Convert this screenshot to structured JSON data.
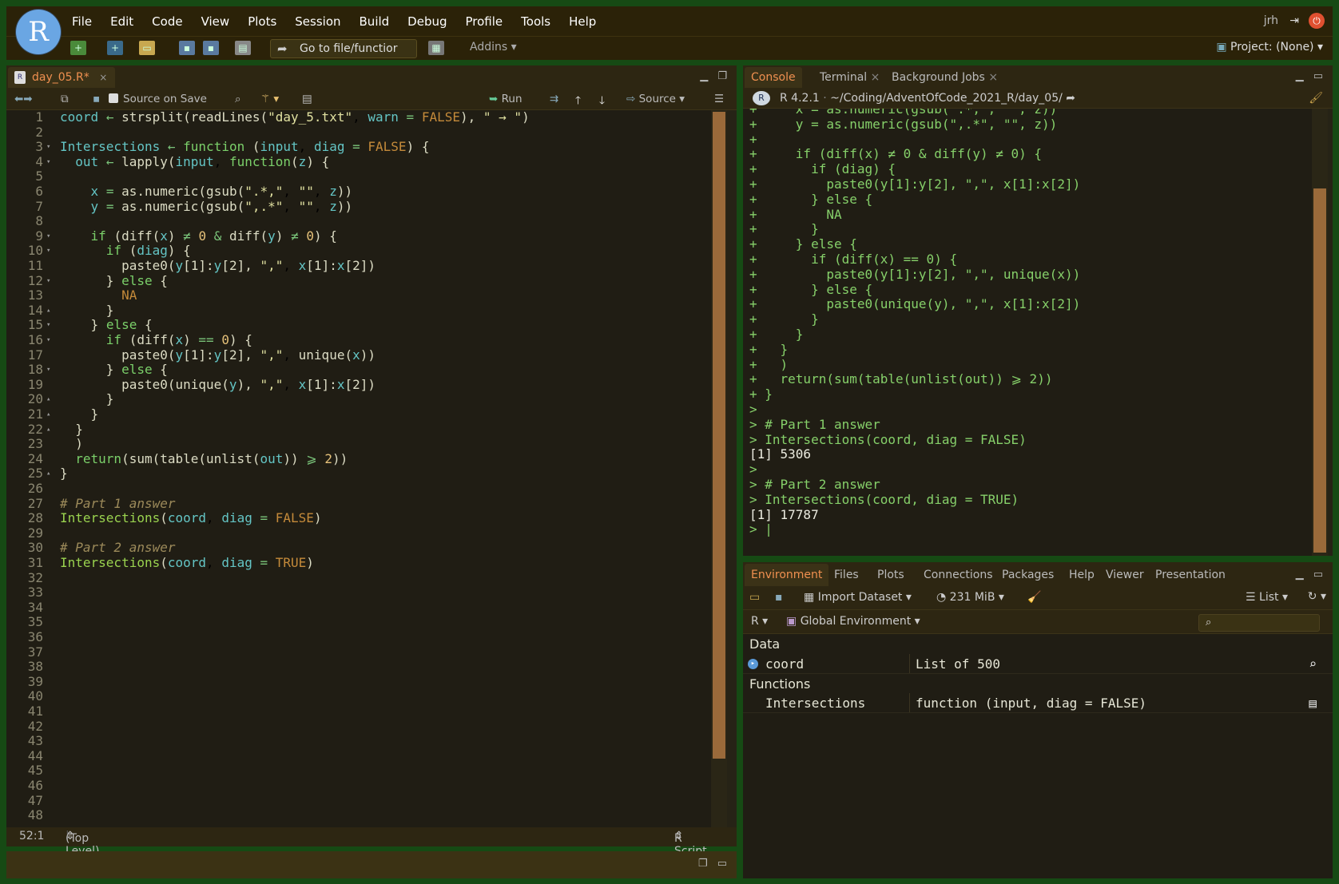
{
  "menubar": {
    "logo": "R",
    "items": [
      "File",
      "Edit",
      "Code",
      "View",
      "Plots",
      "Session",
      "Build",
      "Debug",
      "Profile",
      "Tools",
      "Help"
    ],
    "user": "jrh"
  },
  "toolbar": {
    "goto_placeholder": "Go to file/functior",
    "addins": "Addins",
    "project": "Project: (None)"
  },
  "editor": {
    "tab_label": "day_05.R*",
    "source_on_save": "Source on Save",
    "run_label": "Run",
    "source_label": "Source",
    "status_pos": "52:1",
    "status_scope": "(Top Level)",
    "status_type": "R Script",
    "line_numbers": [
      "1",
      "2",
      "3",
      "4",
      "5",
      "6",
      "7",
      "8",
      "9",
      "10",
      "11",
      "12",
      "13",
      "14",
      "15",
      "16",
      "17",
      "18",
      "19",
      "20",
      "21",
      "22",
      "23",
      "24",
      "25",
      "26",
      "27",
      "28",
      "29",
      "30",
      "31",
      "32",
      "33",
      "34",
      "35",
      "36",
      "37",
      "38",
      "39",
      "40",
      "41",
      "42",
      "43",
      "44",
      "45",
      "46",
      "47",
      "48"
    ]
  },
  "console": {
    "tabs": [
      "Console",
      "Terminal",
      "Background Jobs"
    ],
    "r_version": "R 4.2.1",
    "path": "~/Coding/AdventOfCode_2021_R/day_05/",
    "lines": [
      "+     x = as.numeric(gsub(\".*,\", \"\", z))",
      "+     y = as.numeric(gsub(\",.*\", \"\", z))",
      "+ ",
      "+     if (diff(x) ≠ 0 & diff(y) ≠ 0) {",
      "+       if (diag) {",
      "+         paste0(y[1]:y[2], \",\", x[1]:x[2])",
      "+       } else {",
      "+         NA",
      "+       }",
      "+     } else {",
      "+       if (diff(x) == 0) {",
      "+         paste0(y[1]:y[2], \",\", unique(x))",
      "+       } else {",
      "+         paste0(unique(y), \",\", x[1]:x[2])",
      "+       }",
      "+     }",
      "+   }",
      "+   )",
      "+   return(sum(table(unlist(out)) ⩾ 2))",
      "+ }",
      ">",
      "> # Part 1 answer",
      "> Intersections(coord, diag = FALSE)",
      "[1] 5306",
      ">",
      "> # Part 2 answer",
      "> Intersections(coord, diag = TRUE)",
      "[1] 17787",
      "> |"
    ]
  },
  "environment": {
    "tabs": [
      "Environment",
      "Files",
      "Plots",
      "Connections",
      "Packages",
      "Help",
      "Viewer",
      "Presentation"
    ],
    "import_dataset": "Import Dataset",
    "memory": "231 MiB",
    "view_mode": "List",
    "lang": "R",
    "scope": "Global Environment",
    "section_data": "Data",
    "section_functions": "Functions",
    "rows": [
      {
        "name": "coord",
        "value": "List of  500"
      },
      {
        "name": "Intersections",
        "value": "function (input, diag = FALSE)"
      }
    ]
  }
}
